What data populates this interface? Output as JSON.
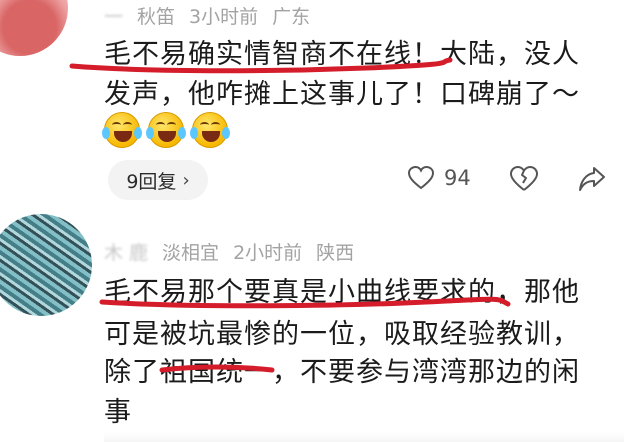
{
  "comment1": {
    "username": "秋笛",
    "username_prefix_blurred": "一",
    "time": "3小时前",
    "location": "广东",
    "lines": [
      "毛不易确实情智商不在线！大陆，没人",
      "发声，他咋摊上这事儿了！口碑崩了～"
    ],
    "emoji_count": 3,
    "replies_label": "9回复",
    "like_count": "94"
  },
  "comment2": {
    "username": "淡相宜",
    "username_prefix_blurred": "木 鹿",
    "time": "2小时前",
    "location": "陕西",
    "lines": [
      "毛不易那个要真是小曲线要求的，那他",
      "可是被坑最惨的一位，吸取经验教训，",
      "除了祖国统一，不要参与湾湾那边的闲",
      "事"
    ]
  },
  "colors": {
    "underline": "#d41c2a",
    "meta": "#a3a3a3",
    "text": "#1b1b1b"
  }
}
